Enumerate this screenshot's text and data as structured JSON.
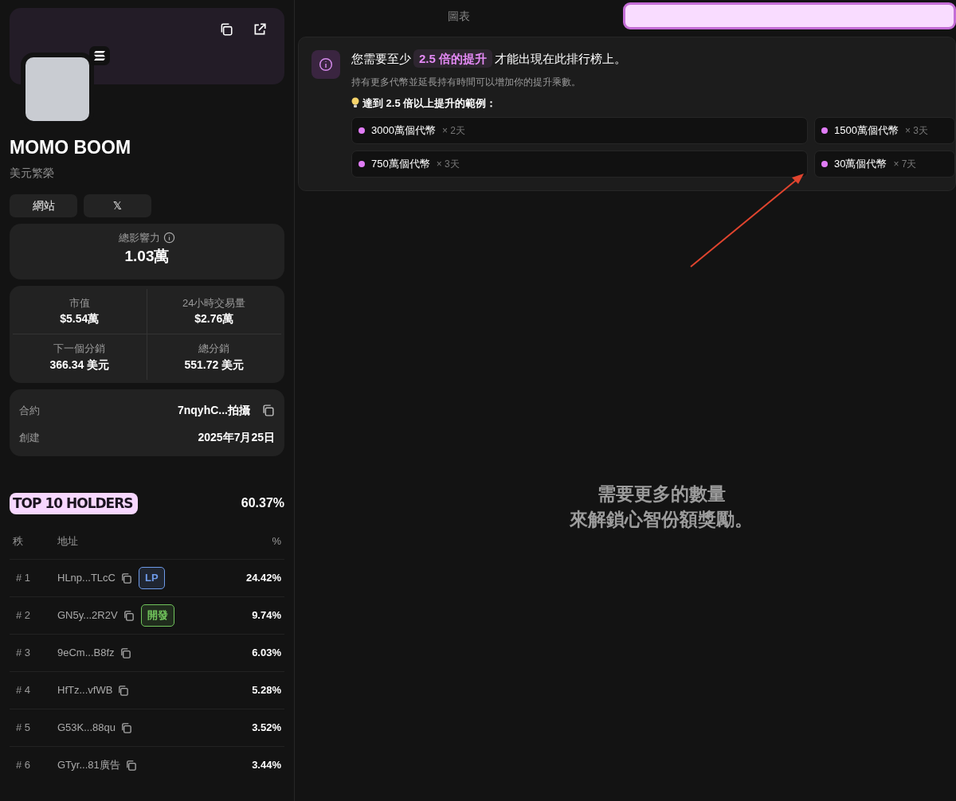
{
  "token": {
    "name": "MOMO BOOM",
    "subtitle": "美元繁榮",
    "links": [
      {
        "kind": "text",
        "label": "網站"
      },
      {
        "kind": "text",
        "label": "𝕏"
      }
    ]
  },
  "influence": {
    "label": "總影響力",
    "value": "1.03萬"
  },
  "stats": [
    {
      "label": "市值",
      "value": "$5.54萬"
    },
    {
      "label": "24小時交易量",
      "value": "$2.76萬"
    },
    {
      "label": "下一個分銷",
      "value": "366.34 美元"
    },
    {
      "label": "總分銷",
      "value": "551.72 美元"
    }
  ],
  "details": [
    {
      "label": "合約",
      "value": "7nqyhC...拍攝",
      "copy": true
    },
    {
      "label": "創建",
      "value": "2025年7月25日",
      "copy": false
    }
  ],
  "holders": {
    "title": "TOP 10 HOLDERS",
    "total": "60.37%",
    "columns": [
      "秩",
      "地址",
      "%"
    ],
    "rows": [
      {
        "rank": "# 1",
        "address": "HLnp...TLcC",
        "tag": {
          "label": "LP",
          "color": "#6e9bea"
        },
        "percent": "24.42%"
      },
      {
        "rank": "# 2",
        "address": "GN5y...2R2V",
        "tag": {
          "label": "開發",
          "color": "#71c45c"
        },
        "percent": "9.74%"
      },
      {
        "rank": "# 3",
        "address": "9eCm...B8fz",
        "percent": "6.03%"
      },
      {
        "rank": "# 4",
        "address": "HfTz...vfWB",
        "percent": "5.28%"
      },
      {
        "rank": "# 5",
        "address": "G53K...88qu",
        "percent": "3.52%"
      },
      {
        "rank": "# 6",
        "address": "GTyr...81廣告",
        "percent": "3.44%"
      }
    ]
  },
  "tabs": [
    {
      "label": "圖表",
      "selected": false
    },
    {
      "selected": true
    }
  ],
  "notice": {
    "before": "您需要至少",
    "highlight": "2.5 倍的提升",
    "after": "才能出現在此排行榜上。",
    "hint": "持有更多代幣並延長持有時間可以增加你的提升乘數。",
    "examples_title": "達到 2.5 倍以上提升的範例：",
    "examples": [
      {
        "amount": "3000萬個代幣",
        "duration": "× 2天"
      },
      {
        "amount": "1500萬個代幣",
        "duration": "× 3天"
      },
      {
        "amount": "750萬個代幣",
        "duration": "× 3天"
      },
      {
        "amount": "30萬個代幣",
        "duration": "× 7天"
      }
    ]
  },
  "empty_state": [
    "需要更多的數量",
    "來解鎖心智份額獎勵。"
  ]
}
